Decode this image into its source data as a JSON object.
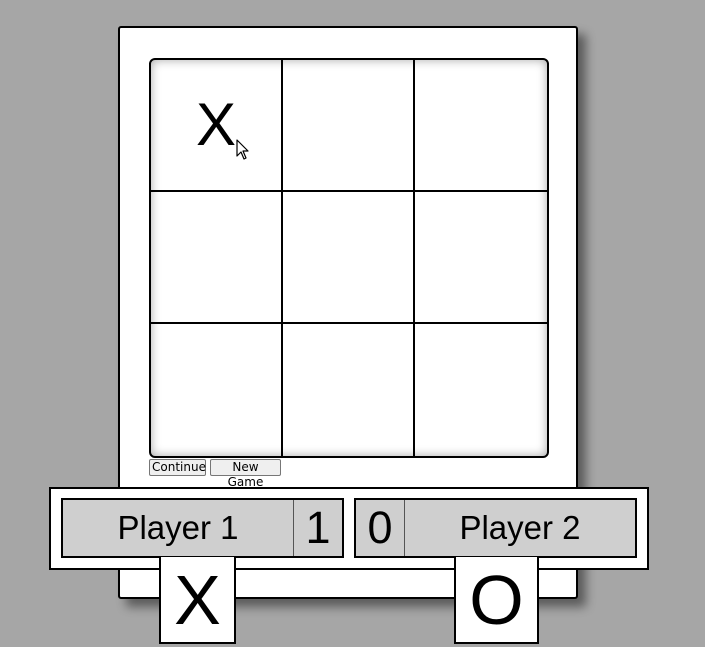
{
  "board": {
    "cells": [
      [
        "X",
        "",
        ""
      ],
      [
        "",
        "",
        ""
      ],
      [
        "",
        "",
        ""
      ]
    ]
  },
  "controls": {
    "continue_label": "Continue",
    "new_game_label": "New Game"
  },
  "players": [
    {
      "name": "Player 1",
      "score": "1",
      "symbol": "X"
    },
    {
      "name": "Player 2",
      "score": "0",
      "symbol": "O"
    }
  ],
  "colors": {
    "background": "#a6a6a6",
    "card": "#ffffff",
    "player_box": "#cfcfcf",
    "line": "#000000"
  },
  "icons": {
    "cursor": "mouse-pointer-icon"
  }
}
